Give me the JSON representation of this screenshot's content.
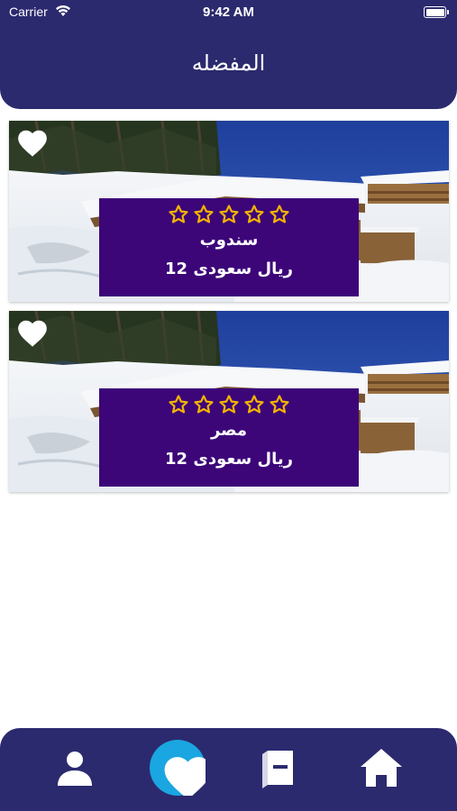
{
  "status_bar": {
    "carrier": "Carrier",
    "time": "9:42 AM"
  },
  "header": {
    "title": "المفضله"
  },
  "favorites": [
    {
      "name": "سندوب",
      "price": "ريال سعودى 12",
      "rating": 0,
      "max_rating": 5,
      "favorited": true,
      "image": "snowy-chalet-photo"
    },
    {
      "name": "مصر",
      "price": "ريال سعودى 12",
      "rating": 0,
      "max_rating": 5,
      "favorited": true,
      "image": "snowy-chalet-photo"
    }
  ],
  "tab_bar": {
    "items": [
      {
        "icon": "person-icon"
      },
      {
        "icon": "heart-icon",
        "active": true
      },
      {
        "icon": "book-icon"
      },
      {
        "icon": "home-icon"
      }
    ]
  },
  "colors": {
    "header_bg": "#2c2a6e",
    "card_info_bg": "#3c0679",
    "star": "#f5b301",
    "active_tab": "#1aa6e0",
    "white": "#ffffff"
  }
}
